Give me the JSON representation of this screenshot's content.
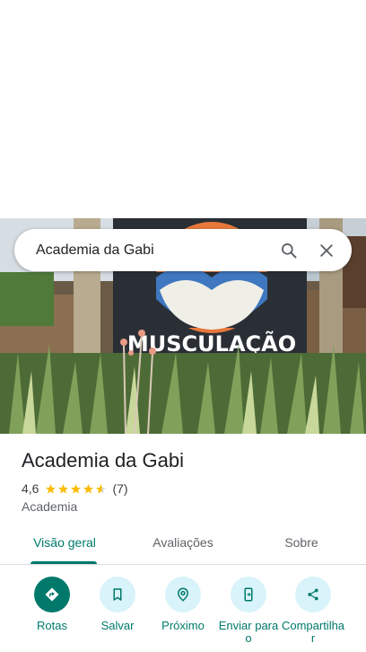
{
  "search": {
    "query": "Academia da Gabi"
  },
  "place": {
    "name": "Academia da Gabi",
    "rating": "4,6",
    "rating_value": 4.6,
    "review_count": "(7)",
    "category": "Academia",
    "photo_sign_text": "MUSCULAÇÃO"
  },
  "tabs": [
    {
      "label": "Visão geral",
      "active": true
    },
    {
      "label": "Avaliações",
      "active": false
    },
    {
      "label": "Sobre",
      "active": false
    }
  ],
  "actions": [
    {
      "label": "Rotas",
      "icon": "directions-icon"
    },
    {
      "label": "Salvar",
      "icon": "bookmark-icon"
    },
    {
      "label": "Próximo",
      "icon": "nearby-icon"
    },
    {
      "label": "Enviar para o",
      "icon": "send-to-phone-icon"
    },
    {
      "label": "Compartilha r",
      "icon": "share-icon"
    }
  ],
  "colors": {
    "accent": "#00796b",
    "action_bg": "#d8f3f9",
    "star": "#fbbc04"
  }
}
